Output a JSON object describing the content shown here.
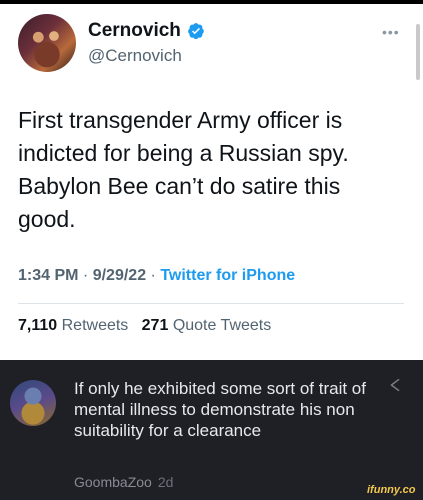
{
  "tweet": {
    "display_name": "Cernovich",
    "handle": "@Cernovich",
    "more_icon": "more-icon",
    "text": "First transgender Army officer is indicted for being a Russian spy. Babylon Bee can’t do satire this good.",
    "time": "1:34 PM",
    "date": "9/29/22",
    "source": "Twitter for iPhone",
    "retweets_count": "7,110",
    "retweets_label": "Retweets",
    "quotes_count": "271",
    "quotes_label": "Quote Tweets",
    "verified_color": "#1d9bf0"
  },
  "reply": {
    "text": "If only he exhibited some sort of trait of mental illness to demonstrate his non suitability for a clearance",
    "username": "GoombaZoo",
    "ago": "2d"
  },
  "watermark": "ifunny.co"
}
